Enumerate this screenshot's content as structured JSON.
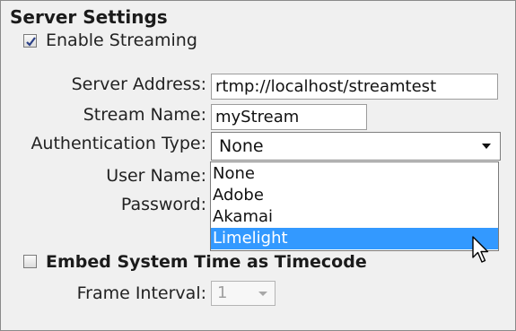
{
  "section_title": "Server Settings",
  "enable_streaming": {
    "label": "Enable Streaming",
    "checked": true
  },
  "server_address": {
    "label": "Server Address:",
    "value": "rtmp://localhost/streamtest"
  },
  "stream_name": {
    "label": "Stream Name:",
    "value": "myStream"
  },
  "authentication_type": {
    "label": "Authentication Type:",
    "selected": "None",
    "options": [
      "None",
      "Adobe",
      "Akamai",
      "Limelight"
    ],
    "highlighted": "Limelight"
  },
  "user_name": {
    "label": "User Name:"
  },
  "password": {
    "label": "Password:"
  },
  "embed_time": {
    "label": "Embed System Time as Timecode",
    "checked": false
  },
  "frame_interval": {
    "label": "Frame Interval:",
    "value": "1"
  },
  "colors": {
    "highlight": "#3399ff",
    "background": "#f0f0f0"
  },
  "icons": {
    "cursor": "arrow-cursor-icon",
    "check": "checkmark-icon",
    "caret": "chevron-down-icon"
  }
}
